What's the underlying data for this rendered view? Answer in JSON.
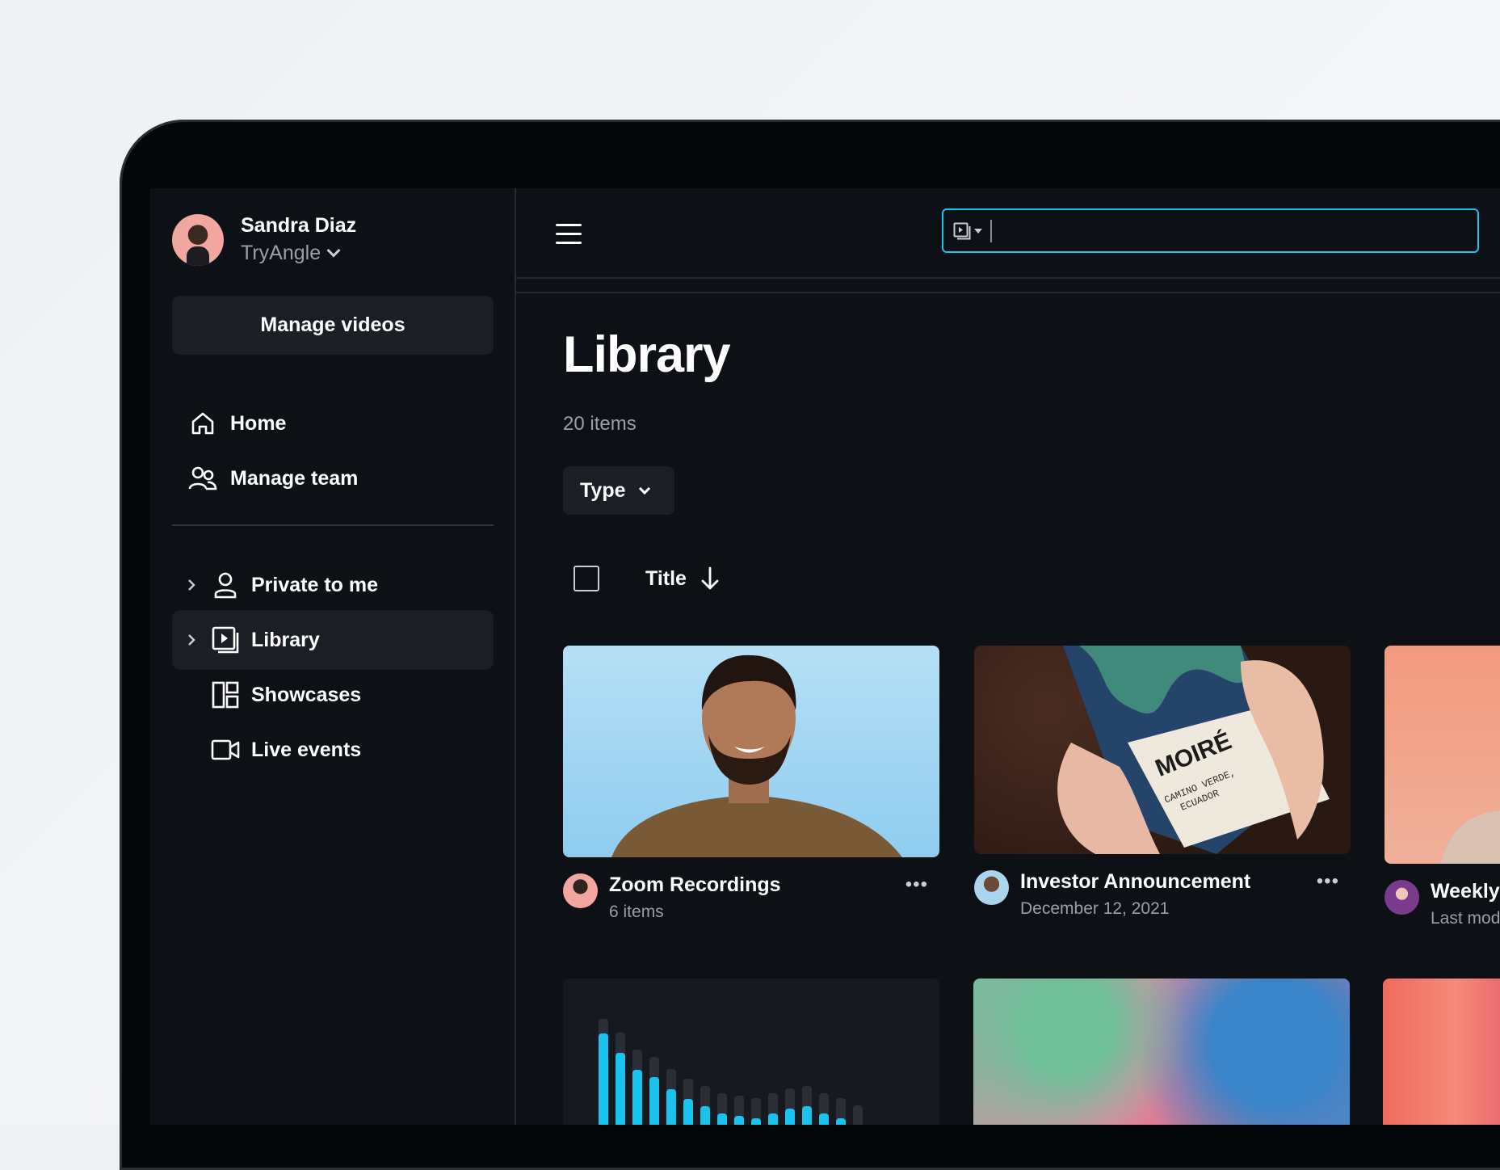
{
  "user": {
    "name": "Sandra Diaz",
    "org": "TryAngle"
  },
  "sidebar": {
    "manage_videos": "Manage videos",
    "top_items": [
      {
        "label": "Home",
        "icon": "home-icon"
      },
      {
        "label": "Manage team",
        "icon": "team-icon"
      }
    ],
    "folders": [
      {
        "label": "Private to me",
        "icon": "person-icon",
        "expandable": true
      },
      {
        "label": "Library",
        "icon": "library-icon",
        "expandable": true,
        "active": true
      },
      {
        "label": "Showcases",
        "icon": "showcase-icon",
        "expandable": false
      },
      {
        "label": "Live events",
        "icon": "video-camera-icon",
        "expandable": false
      }
    ]
  },
  "search": {
    "value": "",
    "placeholder": ""
  },
  "page": {
    "title": "Library",
    "count": "20 items",
    "filter": "Type",
    "sort_label": "Title"
  },
  "cards": [
    {
      "title": "Zoom Recordings",
      "subtitle": "6 items"
    },
    {
      "title": "Investor Announcement",
      "subtitle": "December 12, 2021"
    },
    {
      "title": "Weekly",
      "subtitle": "Last mod"
    }
  ],
  "thumb2_text": {
    "brand": "MOIRÉ",
    "line1": "CAMINO VERDE,",
    "line2": "ECUADOR"
  },
  "chart_data": {
    "type": "bar",
    "values": [
      88,
      72,
      58,
      52,
      42,
      34,
      28,
      22,
      20,
      18,
      22,
      26,
      28,
      22,
      18,
      12
    ]
  },
  "colors": {
    "accent": "#19c3ee",
    "bg": "#0d1014",
    "surface": "#1b1f25"
  }
}
